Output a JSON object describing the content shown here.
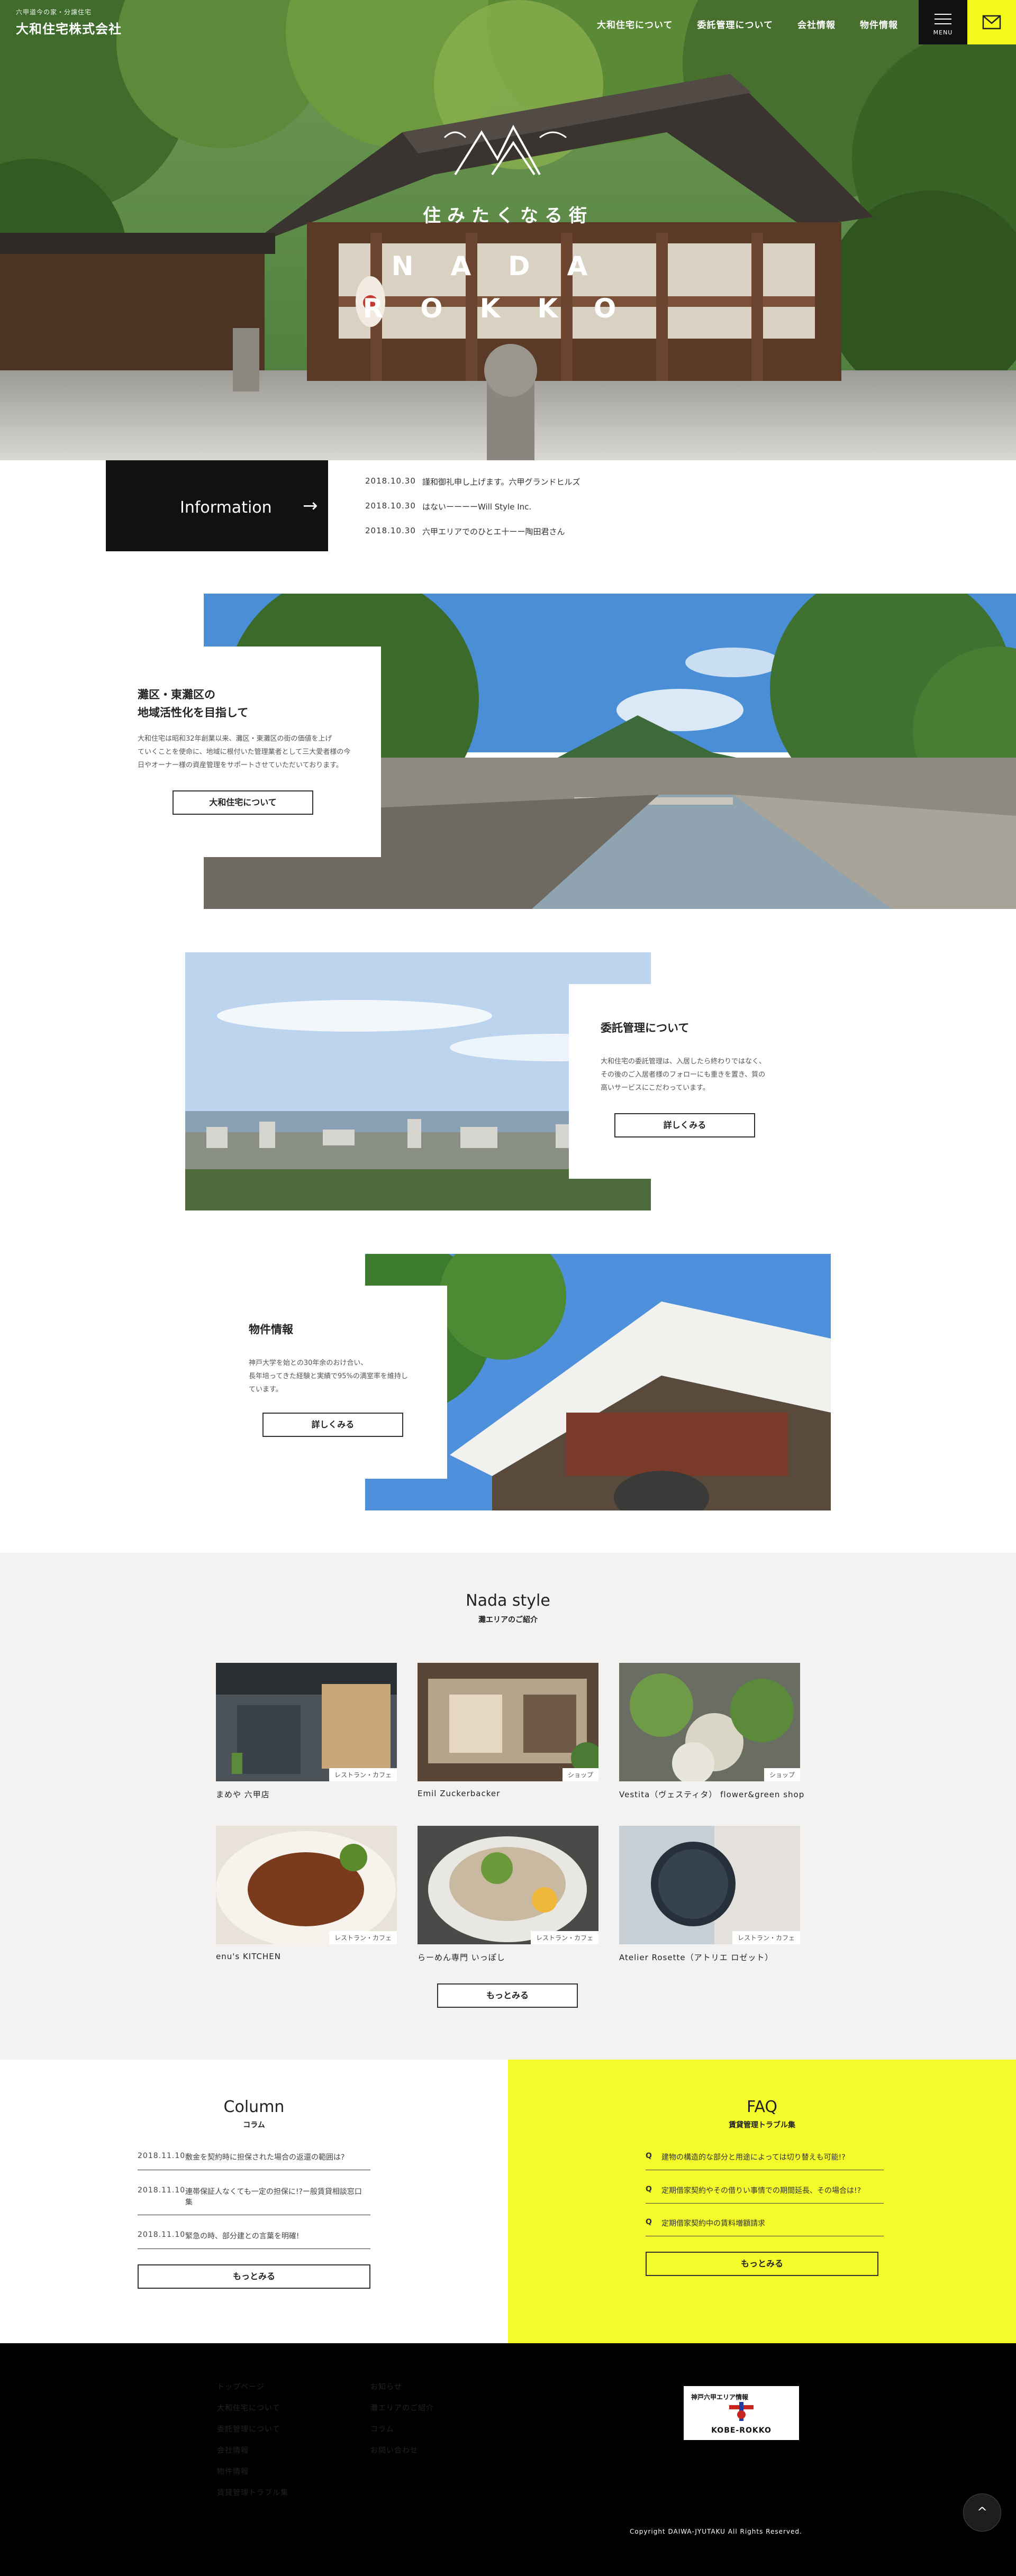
{
  "header": {
    "logo_sub": "六甲道今の家・分譲住宅",
    "logo_main": "大和住宅株式会社",
    "nav": [
      "大和住宅について",
      "委託管理について",
      "会社情報",
      "物件情報"
    ],
    "menu_label": "MENU"
  },
  "hero": {
    "catch_jp": "住みたくなる街",
    "line1": "NADA",
    "line2": "ROKKO"
  },
  "information": {
    "label": "Information",
    "arrow": "→",
    "items": [
      {
        "date": "2018.10.30",
        "text": "謹和御礼申し上げます。六甲グランドヒルズ"
      },
      {
        "date": "2018.10.30",
        "text": "はないーーーーWill Style Inc."
      },
      {
        "date": "2018.10.30",
        "text": "六甲エリアでのひとエ十ーー陶田君さん"
      }
    ]
  },
  "features": [
    {
      "title_l1": "灘区・東灘区の",
      "title_l2": "地域活性化を目指して",
      "body": [
        "大和住宅は昭和32年創業以来、灘区・東灘区の街の価値を上げ",
        "ていくことを使命に、地域に根付いた管理業者として三大愛者様の今",
        "日やオーナー様の資産管理をサポートさせていただいております。"
      ],
      "button": "大和住宅について"
    },
    {
      "title_l1": "委託管理について",
      "title_l2": "",
      "body": [
        "大和住宅の委託管理は、入居したら終わりではなく、",
        "その後のご入居者様のフォローにも重きを置き、質の",
        "高いサービスにこだわっています。"
      ],
      "button": "詳しくみる"
    },
    {
      "title_l1": "物件情報",
      "title_l2": "",
      "body": [
        "神戸大学を始との30年余のおけ合い、",
        "長年培ってきた経験と実績で95%の満室率を維持し",
        "ています。"
      ],
      "button": "詳しくみる"
    }
  ],
  "nada_style": {
    "title_en": "Nada style",
    "title_jp": "灘エリアのご紹介",
    "shops": [
      {
        "name": "まめや 六甲店",
        "tag": "レストラン・カフェ"
      },
      {
        "name": "Emil Zuckerbacker",
        "tag": "ショップ"
      },
      {
        "name": "Vestita（ヴェスティタ） flower&green shop",
        "tag": "ショップ"
      },
      {
        "name": "enu's KITCHEN",
        "tag": "レストラン・カフェ"
      },
      {
        "name": "らーめん専門 いっぽし",
        "tag": "レストラン・カフェ"
      },
      {
        "name": "Atelier Rosette（アトリエ ロゼット）",
        "tag": "レストラン・カフェ"
      }
    ],
    "more": "もっとみる"
  },
  "column": {
    "title_en": "Column",
    "title_jp": "コラム",
    "items": [
      {
        "date": "2018.11.10",
        "text": "敷金を契約時に担保された場合の返還の範囲は?"
      },
      {
        "date": "2018.11.10",
        "text": "連帯保証人なくても一定の担保に!?ー般賃貸相談窓口集"
      },
      {
        "date": "2018.11.10",
        "text": "緊急の時、部分建との言葉を明確!"
      }
    ],
    "more": "もっとみる"
  },
  "faq": {
    "title_en": "FAQ",
    "title_jp": "賃貸管理トラブル集",
    "items": [
      {
        "q": "Q",
        "text": "建物の構造的な部分と用途によっては切り替えも可能!?"
      },
      {
        "q": "Q",
        "text": "定期借家契約やその借りい事情での期間延長、その場合は!?"
      },
      {
        "q": "Q",
        "text": "定期借家契約中の賃料増額請求"
      }
    ],
    "more": "もっとみる"
  },
  "footer": {
    "nav_col1": [
      "トップページ",
      "大和住宅について",
      "委託管理について",
      "会社情報",
      "物件情報",
      "賃貸管理トラブル集"
    ],
    "nav_col2": [
      "お知らせ",
      "灘エリアのご紹介",
      "コラム",
      "お問い合わせ"
    ],
    "banner_top": "神戸六甲エリア情報",
    "banner_bottom": "KOBE-ROKKO",
    "copyright": "Copyright DAIWA-JYUTAKU All Rights Reserved.",
    "totop": "^"
  }
}
